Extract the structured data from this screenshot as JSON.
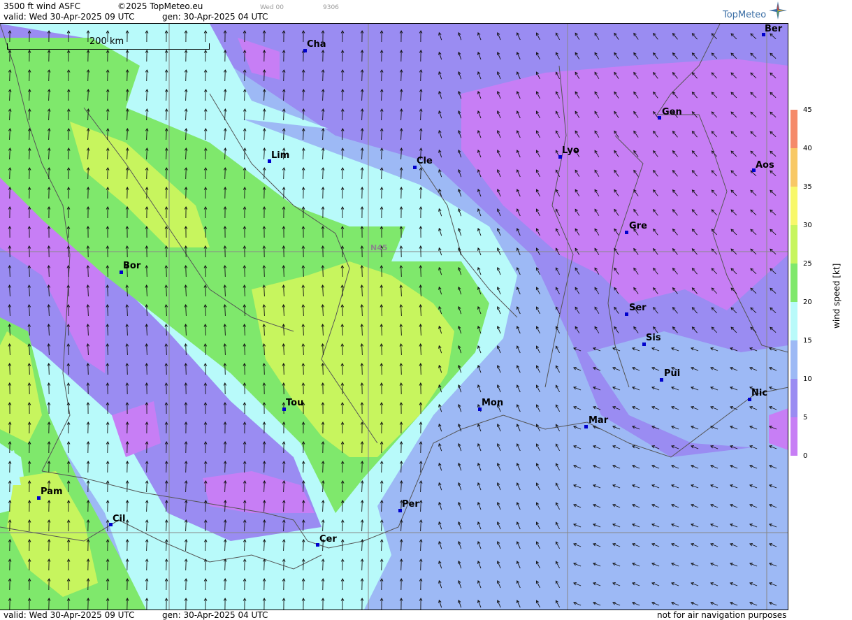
{
  "header": {
    "line1_left": "3500 ft wind ASFC",
    "copyright": "©2025 TopMeteo.eu",
    "valid_time_short": "Wed 00",
    "code": "9306",
    "line2_valid": "valid:  Wed  30-Apr-2025  09 UTC",
    "line2_gen": "gen: 30-Apr-2025 04 UTC"
  },
  "footer": {
    "valid": "valid:  Wed  30-Apr-2025  09 UTC",
    "gen": "gen: 30-Apr-2025 04 UTC",
    "disclaimer": "not for air navigation purposes"
  },
  "logo": {
    "text": "TopMeteo",
    "icon": "compass-star-icon"
  },
  "map": {
    "scale_label": "200 km",
    "lat_label": "N45",
    "cities": [
      {
        "name": "Cha"
      },
      {
        "name": "Ber"
      },
      {
        "name": "Gen"
      },
      {
        "name": "Lim"
      },
      {
        "name": "Cle"
      },
      {
        "name": "Lyo"
      },
      {
        "name": "Aos"
      },
      {
        "name": "Gre"
      },
      {
        "name": "Bor"
      },
      {
        "name": "Ser"
      },
      {
        "name": "Sis"
      },
      {
        "name": "Pui"
      },
      {
        "name": "Tou"
      },
      {
        "name": "Mon"
      },
      {
        "name": "Nic"
      },
      {
        "name": "Mar"
      },
      {
        "name": "Pam"
      },
      {
        "name": "Per"
      },
      {
        "name": "Cil"
      },
      {
        "name": "Cer"
      }
    ]
  },
  "legend": {
    "title": "wind  speed  [kt]",
    "ticks": [
      "45",
      "40",
      "35",
      "30",
      "25",
      "20",
      "15",
      "10",
      "5",
      "0"
    ],
    "colors": {
      "band_0_5": "#c77ef5",
      "band_5_10": "#9a8cf2",
      "band_10_15": "#9db9f5",
      "band_15_20": "#b8fafa",
      "band_20_25": "#7fe86c",
      "band_25_30": "#c7f55e",
      "band_30_35": "#f8f86a",
      "band_35_40": "#f8c865",
      "band_40_45": "#f58a6a"
    }
  }
}
